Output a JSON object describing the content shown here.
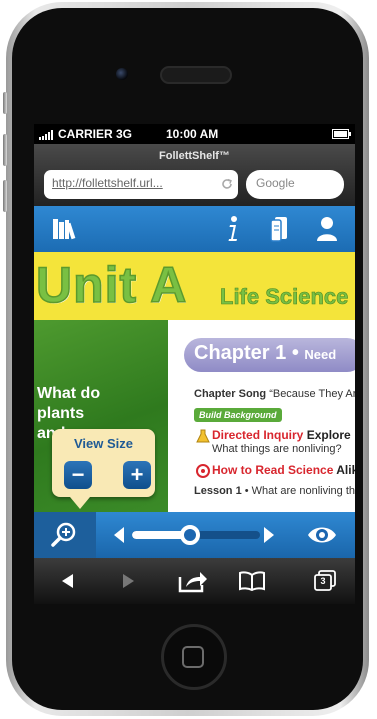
{
  "status_bar": {
    "carrier": "CARRIER 3G",
    "time": "10:00 AM"
  },
  "browser": {
    "title": "FollettShelf™",
    "url": "http://follettshelf.url...",
    "search_placeholder": "Google"
  },
  "book_page": {
    "unit": "Unit A",
    "unit_subject": "Life Science",
    "chapter": "Chapter 1",
    "chapter_cut": "Need",
    "question": "What do plants and an",
    "toc": {
      "chapter_song_label": "Chapter Song",
      "chapter_song_title": "“Because They Ar",
      "build_background": "Build Background",
      "directed_inquiry": "Directed Inquiry",
      "explore": "Explore",
      "directed_question": "What things are nonliving?",
      "how_to_read": "How to Read Science",
      "how_to_read_tail": "Alike",
      "lesson1_label": "Lesson 1",
      "lesson1_text": "What are nonliving th"
    }
  },
  "view_size_popup": {
    "title": "View Size",
    "minus": "−",
    "plus": "+"
  },
  "slider": {
    "position": 0.45
  },
  "colors": {
    "app_blue": "#2a7fcb",
    "popup_bg": "#f9e9b5",
    "unit_green": "#79c043",
    "title_bar_blue": "#1c66b0"
  },
  "tab_count": "3"
}
